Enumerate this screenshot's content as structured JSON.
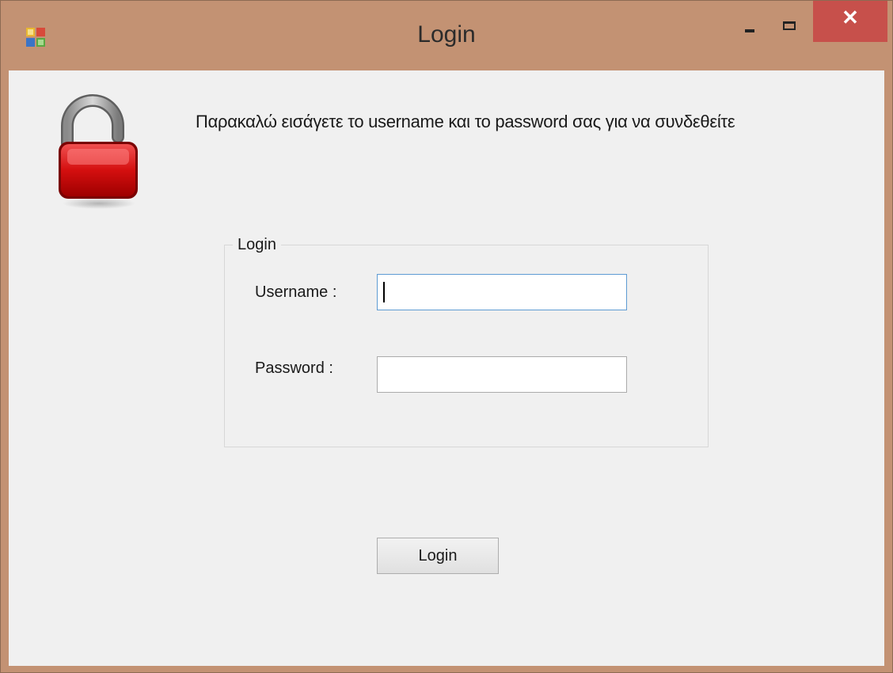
{
  "window": {
    "title": "Login",
    "close_glyph": "✕",
    "icons": {
      "app": "app-icon",
      "minimize": "minimize-icon",
      "maximize": "maximize-icon",
      "close": "close-icon"
    },
    "colors": {
      "frame": "#c39273",
      "close_button": "#c7504b",
      "client_background": "#f0f0f0"
    }
  },
  "header": {
    "lock_icon": "unlocked-padlock-icon",
    "instruction": "Παρακαλώ εισάγετε το username και το password σας για να συνδεθείτε"
  },
  "login_group": {
    "legend": "Login",
    "username_label": "Username :",
    "username_value": "",
    "password_label": "Password :",
    "password_value": ""
  },
  "actions": {
    "login_label": "Login"
  }
}
